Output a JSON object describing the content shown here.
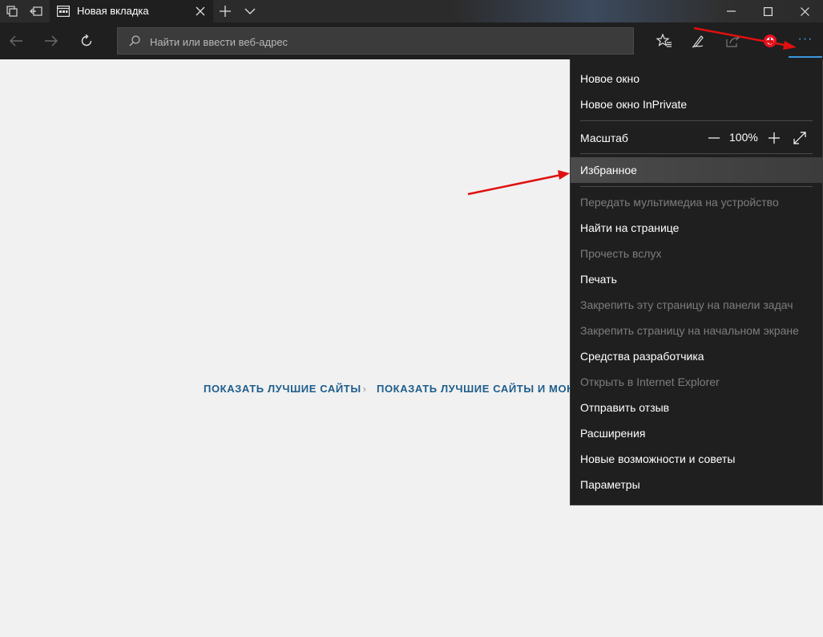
{
  "tab": {
    "title": "Новая вкладка"
  },
  "address_bar": {
    "placeholder": "Найти или ввести веб-адрес"
  },
  "page": {
    "top_sites_label": "ПОКАЗАТЬ ЛУЧШИЕ САЙТЫ",
    "top_sites_and_feed_label": "ПОКАЗАТЬ ЛУЧШИЕ САЙТЫ И МОЮ"
  },
  "menu": {
    "new_window": "Новое окно",
    "new_inprivate_window": "Новое окно InPrivate",
    "zoom_label": "Масштаб",
    "zoom_value": "100%",
    "favorites": "Избранное",
    "cast_media": "Передать мультимедиа на устройство",
    "find_on_page": "Найти на странице",
    "read_aloud": "Прочесть вслух",
    "print": "Печать",
    "pin_taskbar": "Закрепить эту страницу на панели задач",
    "pin_start": "Закрепить страницу на начальном экране",
    "dev_tools": "Средства разработчика",
    "open_ie": "Открыть в Internet Explorer",
    "send_feedback": "Отправить отзыв",
    "extensions": "Расширения",
    "whats_new": "Новые возможности и советы",
    "settings": "Параметры"
  },
  "colors": {
    "accent": "#3a96dd",
    "annotation_arrow": "#e01010",
    "link": "#1e5d8c"
  },
  "icons": {
    "tab_manager": "tab-manager-icon",
    "set_aside": "set-aside-tabs-icon",
    "favorites": "favorites-star-icon",
    "notes": "pen-notes-icon",
    "share": "share-icon",
    "extension": "extension-icon",
    "more": "more-dots-icon"
  }
}
